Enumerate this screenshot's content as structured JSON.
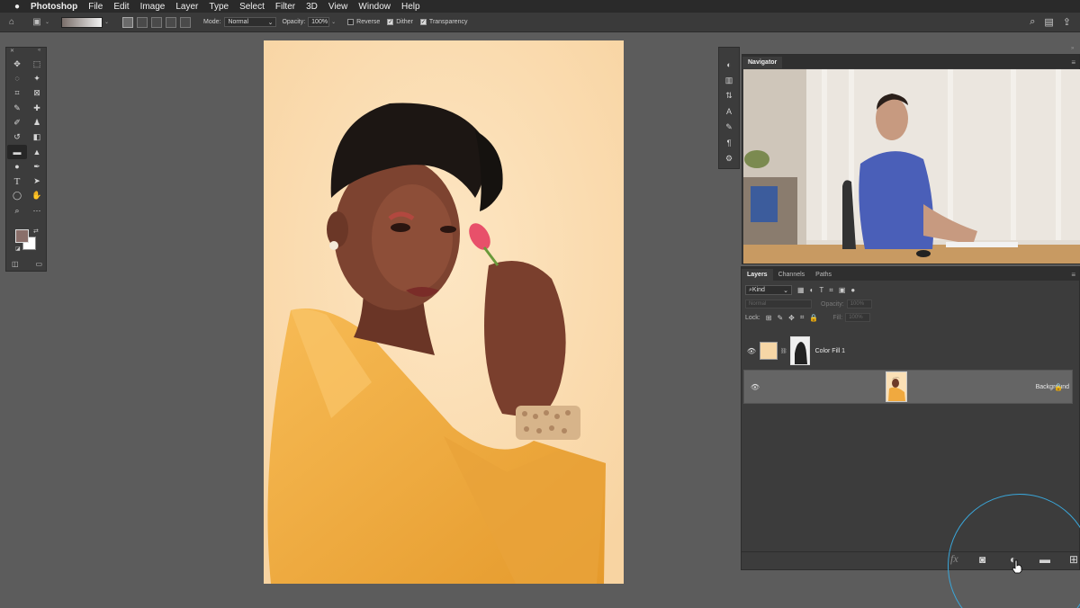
{
  "menubar": {
    "app_name": "Photoshop",
    "items": [
      "File",
      "Edit",
      "Image",
      "Layer",
      "Type",
      "Select",
      "Filter",
      "3D",
      "View",
      "Window",
      "Help"
    ]
  },
  "options_bar": {
    "mode_label": "Mode:",
    "mode_value": "Normal",
    "opacity_label": "Opacity:",
    "opacity_value": "100%",
    "reverse_label": "Reverse",
    "dither_label": "Dither",
    "transparency_label": "Transparency",
    "reverse_checked": false,
    "dither_checked": true,
    "transparency_checked": true
  },
  "colors": {
    "foreground": "#8a6f6a",
    "background": "#ffffff",
    "accent_ring": "#3aa6d9",
    "canvas_background": "#fbdcb0",
    "color_fill_layer": "#f6d6a6"
  },
  "navigator": {
    "tab_label": "Navigator"
  },
  "layers_panel": {
    "tabs": [
      "Layers",
      "Channels",
      "Paths"
    ],
    "filter_kind": "Kind",
    "blend_mode": "Normal",
    "opacity_label": "Opacity:",
    "opacity_value": "100%",
    "lock_label": "Lock:",
    "fill_label": "Fill:",
    "fill_value": "100%",
    "layers": [
      {
        "name": "Color Fill 1",
        "visible": true,
        "selected": false
      },
      {
        "name": "Background",
        "visible": true,
        "selected": true,
        "locked": true
      }
    ]
  }
}
